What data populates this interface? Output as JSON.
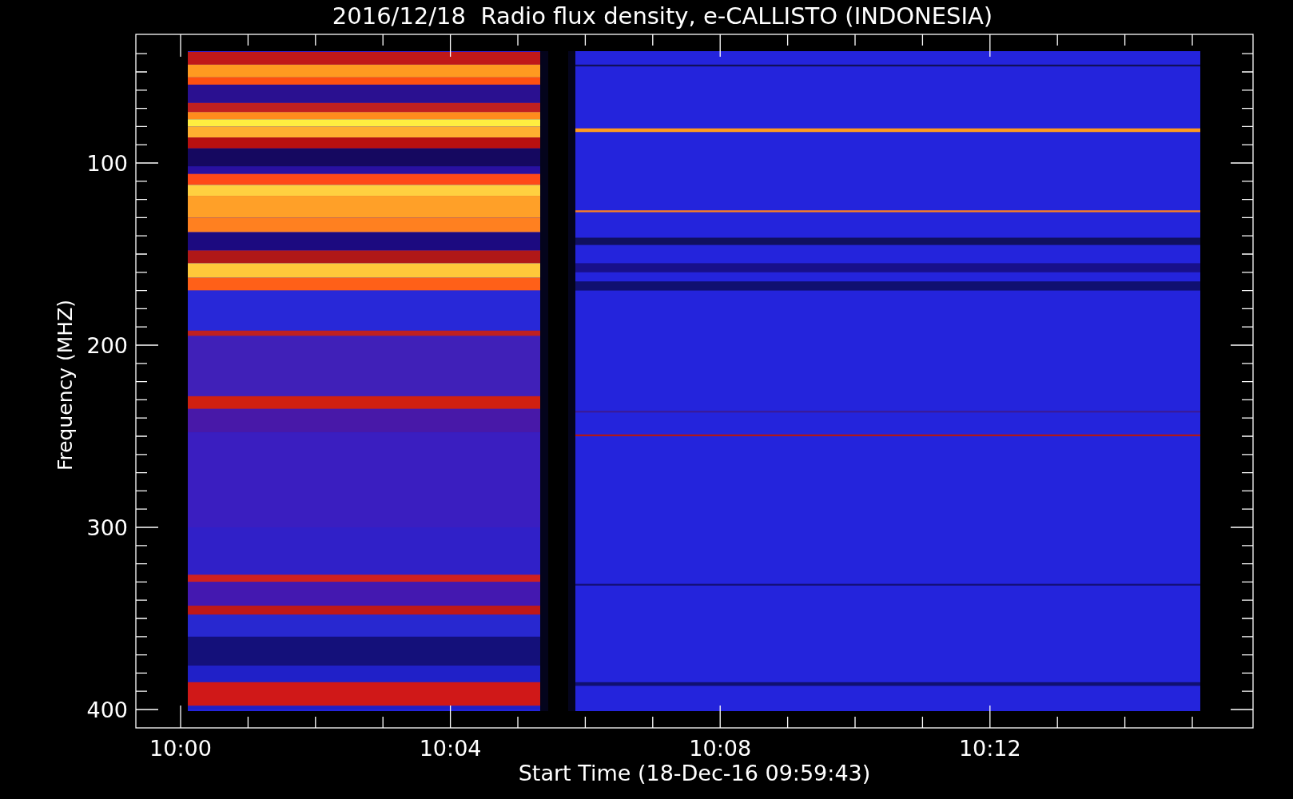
{
  "title": "2016/12/18  Radio flux density, e-CALLISTO (INDONESIA)",
  "y_axis": {
    "label": "Frequency (MHZ)",
    "ticks": [
      "100",
      "200",
      "300",
      "400"
    ]
  },
  "x_axis": {
    "label": "Start Time (18-Dec-16 09:59:43)",
    "ticks": [
      "10:00",
      "10:04",
      "10:08",
      "10:12"
    ]
  }
}
